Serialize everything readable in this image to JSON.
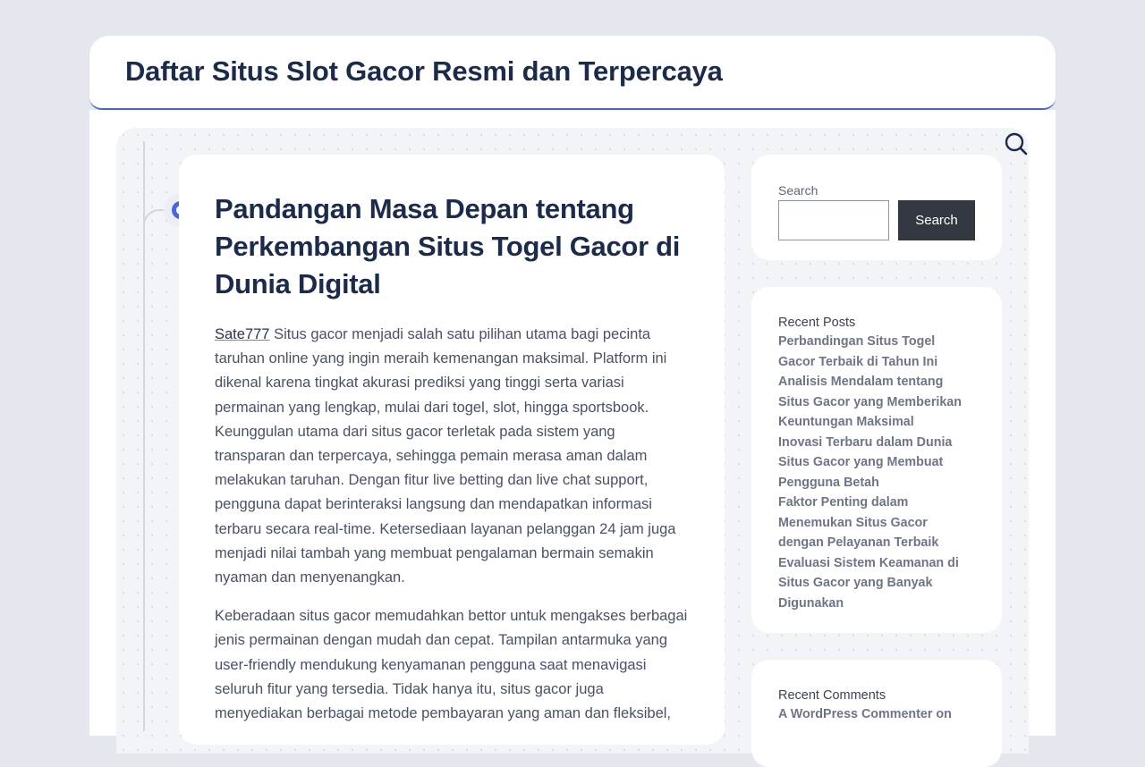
{
  "header": {
    "site_title": "Daftar Situs Slot Gacor Resmi dan Terpercaya"
  },
  "article": {
    "title": "Pandangan Masa Depan tentang Perkembangan Situs Togel Gacor di Dunia Digital",
    "link_text": "Sate777",
    "paragraph1": " Situs gacor menjadi salah satu pilihan utama bagi pecinta taruhan online yang ingin meraih kemenangan maksimal. Platform ini dikenal karena tingkat akurasi prediksi yang tinggi serta variasi permainan yang lengkap, mulai dari togel, slot, hingga sportsbook. Keunggulan utama dari situs gacor terletak pada sistem yang transparan dan terpercaya, sehingga pemain merasa aman dalam melakukan taruhan. Dengan fitur live betting dan live chat support, pengguna dapat berinteraksi langsung dan mendapatkan informasi terbaru secara real-time. Ketersediaan layanan pelanggan 24 jam juga menjadi nilai tambah yang membuat pengalaman bermain semakin nyaman dan menyenangkan.",
    "paragraph2": "Keberadaan situs gacor memudahkan bettor untuk mengakses berbagai jenis permainan dengan mudah dan cepat. Tampilan antarmuka yang user-friendly mendukung kenyamanan pengguna saat menavigasi seluruh fitur yang tersedia. Tidak hanya itu, situs gacor juga menyediakan berbagai metode pembayaran yang aman dan fleksibel,"
  },
  "search_widget": {
    "label": "Search",
    "button_label": "Search",
    "input_value": ""
  },
  "recent_posts": {
    "heading": "Recent Posts",
    "items": [
      {
        "label": "Perbandingan Situs Togel Gacor Terbaik di Tahun Ini"
      },
      {
        "label": "Analisis Mendalam tentang Situs Gacor yang Memberikan Keuntungan Maksimal"
      },
      {
        "label": "Inovasi Terbaru dalam Dunia Situs Gacor yang Membuat Pengguna Betah"
      },
      {
        "label": "Faktor Penting dalam Menemukan Situs Gacor dengan Pelayanan Terbaik"
      },
      {
        "label": "Evaluasi Sistem Keamanan di Situs Gacor yang Banyak Digunakan"
      }
    ]
  },
  "recent_comments": {
    "heading": "Recent Comments",
    "items": [
      {
        "label": "A WordPress Commenter on"
      }
    ]
  },
  "icons": {
    "search_toggle": "search-icon",
    "timeline_marker": "timeline-dot-icon"
  },
  "colors": {
    "accent": "#4c66d8",
    "title": "#1d2b4a",
    "button": "#333840",
    "background": "#e5e7ee"
  }
}
